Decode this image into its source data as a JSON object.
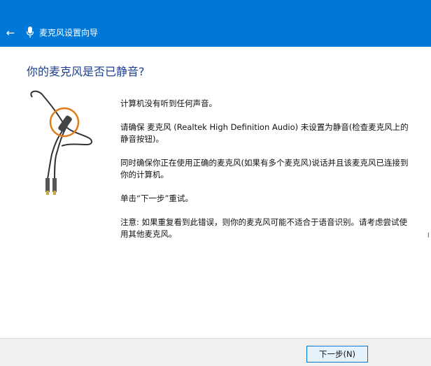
{
  "window": {
    "title": "麦克风设置向导",
    "back_icon": "back-arrow-icon",
    "mic_icon": "microphone-icon",
    "accent_color": "#0078d7"
  },
  "main": {
    "heading": "你的麦克风是否已静音?",
    "illustration": "headset-microphone-illustration",
    "paragraphs": [
      "计算机没有听到任何声音。",
      "请确保 麦克风 (Realtek High Definition Audio) 未设置为静音(检查麦克风上的静音按钮)。",
      "同时确保你正在使用正确的麦克风(如果有多个麦克风)说话并且该麦克风已连接到你的计算机。",
      "单击“下一步”重试。",
      "注意: 如果重复看到此错误，则你的麦克风可能不适合于语音识别。请考虑尝试使用其他麦克风。"
    ],
    "edge_glyph": "l"
  },
  "footer": {
    "next_label": "下一步(N)"
  }
}
